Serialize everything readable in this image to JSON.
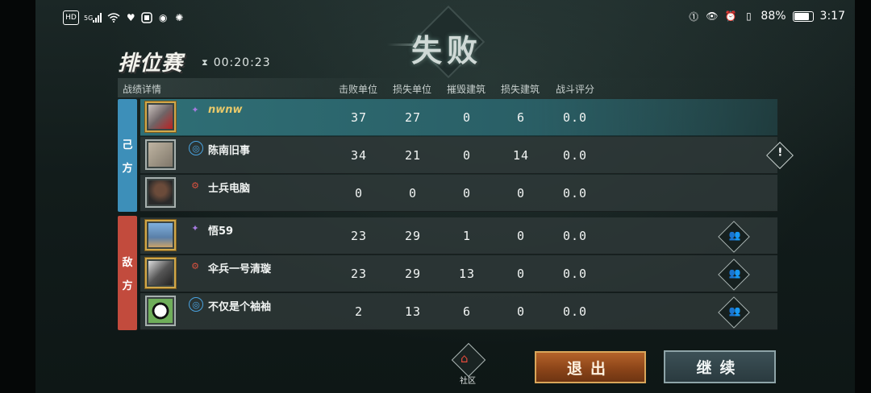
{
  "status_bar": {
    "left_icons": [
      "hd-icon",
      "5g-signal-icon",
      "wifi-icon",
      "heart-icon",
      "app-icon",
      "app2-icon",
      "app3-icon"
    ],
    "hd_label": "HD",
    "network_label": "5G",
    "battery": "88%",
    "time": "3:17"
  },
  "result_banner": "失败",
  "mode_title": "排位赛",
  "timer": "00:20:23",
  "table": {
    "section_label": "战绩详情",
    "columns": [
      "击败单位",
      "损失单位",
      "摧毁建筑",
      "损失建筑",
      "战斗评分"
    ]
  },
  "teams": {
    "ally_label": [
      "己",
      "方"
    ],
    "enemy_label": [
      "敌",
      "方"
    ]
  },
  "ally_rows": [
    {
      "name": "nwnw",
      "values": [
        "37",
        "27",
        "0",
        "6",
        "0.0"
      ],
      "rank_icon": "purple-rank-icon",
      "self": true
    },
    {
      "name": "陈南旧事",
      "values": [
        "34",
        "21",
        "0",
        "14",
        "0.0"
      ],
      "rank_icon": "blue-rank-icon"
    },
    {
      "name": "士兵电脑",
      "values": [
        "0",
        "0",
        "0",
        "0",
        "0.0"
      ],
      "rank_icon": "red-rank-icon"
    }
  ],
  "enemy_rows": [
    {
      "name": "悟59",
      "values": [
        "23",
        "29",
        "1",
        "0",
        "0.0"
      ],
      "rank_icon": "purple-rank-icon"
    },
    {
      "name": "伞兵一号清璇",
      "values": [
        "23",
        "29",
        "13",
        "0",
        "0.0"
      ],
      "rank_icon": "red-rank-icon"
    },
    {
      "name": "不仅是个袖袖",
      "values": [
        "2",
        "13",
        "6",
        "0",
        "0.0"
      ],
      "rank_icon": "blue-rank-icon"
    }
  ],
  "bottom": {
    "community_label": "社区",
    "exit_label": "退出",
    "continue_label": "继续"
  },
  "colors": {
    "ally": "#3d8fb9",
    "enemy": "#c24b3d",
    "self_row": "#2f6f76",
    "exit_button": "#8c4519",
    "continue_button": "#2a3a3f"
  }
}
